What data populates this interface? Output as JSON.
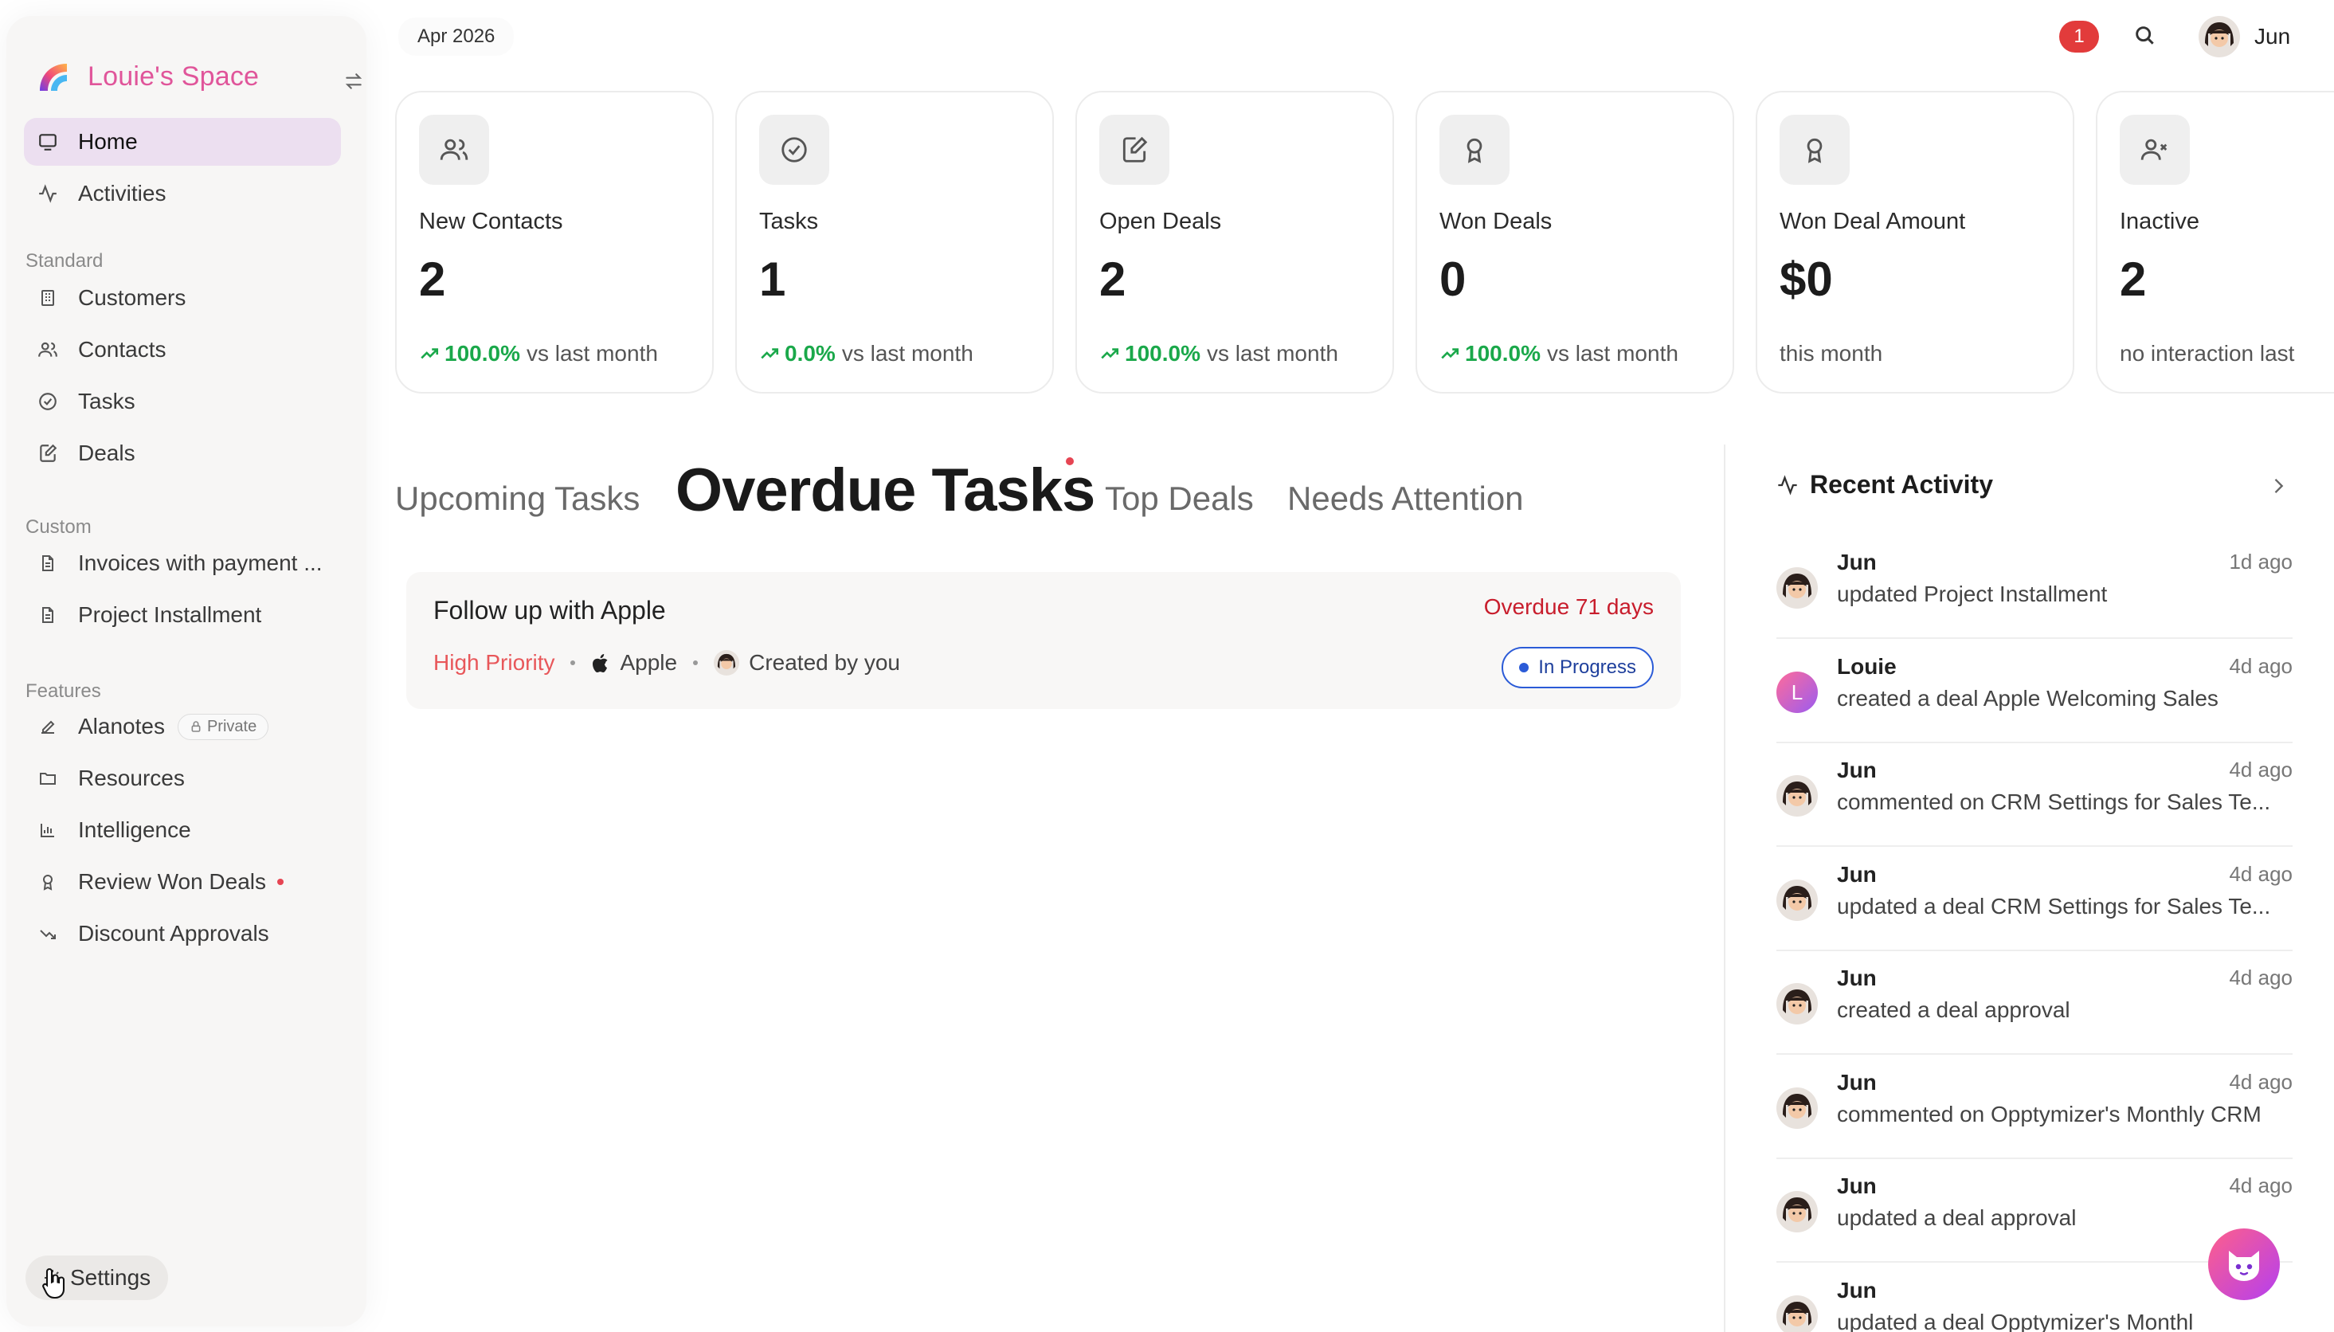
{
  "brand": {
    "name": "Louie's Space"
  },
  "nav": {
    "home": "Home",
    "activities": "Activities",
    "standard_header": "Standard",
    "standard": [
      "Customers",
      "Contacts",
      "Tasks",
      "Deals"
    ],
    "custom_header": "Custom",
    "custom": [
      "Invoices with payment ...",
      "Project Installment"
    ],
    "features_header": "Features",
    "features": [
      {
        "label": "Alanotes",
        "badge": "Private"
      },
      {
        "label": "Resources"
      },
      {
        "label": "Intelligence"
      },
      {
        "label": "Review Won Deals"
      },
      {
        "label": "Discount Approvals"
      }
    ],
    "settings": "Settings"
  },
  "topbar": {
    "date": "Apr 2026",
    "notification_count": "1",
    "user_name": "Jun"
  },
  "stats": [
    {
      "title": "New Contacts",
      "value": "2",
      "pct": "100.0%",
      "suffix": "vs last month",
      "icon": "contacts-icon"
    },
    {
      "title": "Tasks",
      "value": "1",
      "pct": "0.0%",
      "suffix": "vs last month",
      "icon": "check-circle-icon"
    },
    {
      "title": "Open Deals",
      "value": "2",
      "pct": "100.0%",
      "suffix": "vs last month",
      "icon": "edit-doc-icon"
    },
    {
      "title": "Won Deals",
      "value": "0",
      "pct": "100.0%",
      "suffix": "vs last month",
      "icon": "award-icon"
    },
    {
      "title": "Won Deal Amount",
      "value": "$0",
      "suffix": "this month",
      "icon": "award-icon"
    },
    {
      "title": "Inactive",
      "value": "2",
      "suffix": "no interaction last",
      "icon": "user-x-icon"
    }
  ],
  "tabs": [
    "Upcoming Tasks",
    "Overdue Tasks",
    "Top Deals",
    "Needs Attention"
  ],
  "task": {
    "title": "Follow up with Apple",
    "overdue": "Overdue 71 days",
    "priority": "High Priority",
    "company": "Apple",
    "creator": "Created by you",
    "status": "In Progress"
  },
  "activity": {
    "title": "Recent Activity",
    "items": [
      {
        "who": "Jun",
        "when": "1d ago",
        "what": "updated Project Installment"
      },
      {
        "who": "Louie",
        "when": "4d ago",
        "what": "created a deal Apple Welcoming Sales",
        "initial": "L"
      },
      {
        "who": "Jun",
        "when": "4d ago",
        "what": "commented on CRM Settings for Sales Te..."
      },
      {
        "who": "Jun",
        "when": "4d ago",
        "what": "updated a deal CRM Settings for Sales Te..."
      },
      {
        "who": "Jun",
        "when": "4d ago",
        "what": "created a deal approval"
      },
      {
        "who": "Jun",
        "when": "4d ago",
        "what": "commented on Opptymizer's Monthly CRM"
      },
      {
        "who": "Jun",
        "when": "4d ago",
        "what": "updated a deal approval"
      },
      {
        "who": "Jun",
        "when": "",
        "what": "updated a deal Opptymizer's Monthl"
      }
    ]
  },
  "colors": {
    "brand": "#e0559a",
    "positive": "#1aa84a",
    "overdue": "#c81d2c",
    "status": "#2b5bd7",
    "notification": "#e23b3b"
  }
}
